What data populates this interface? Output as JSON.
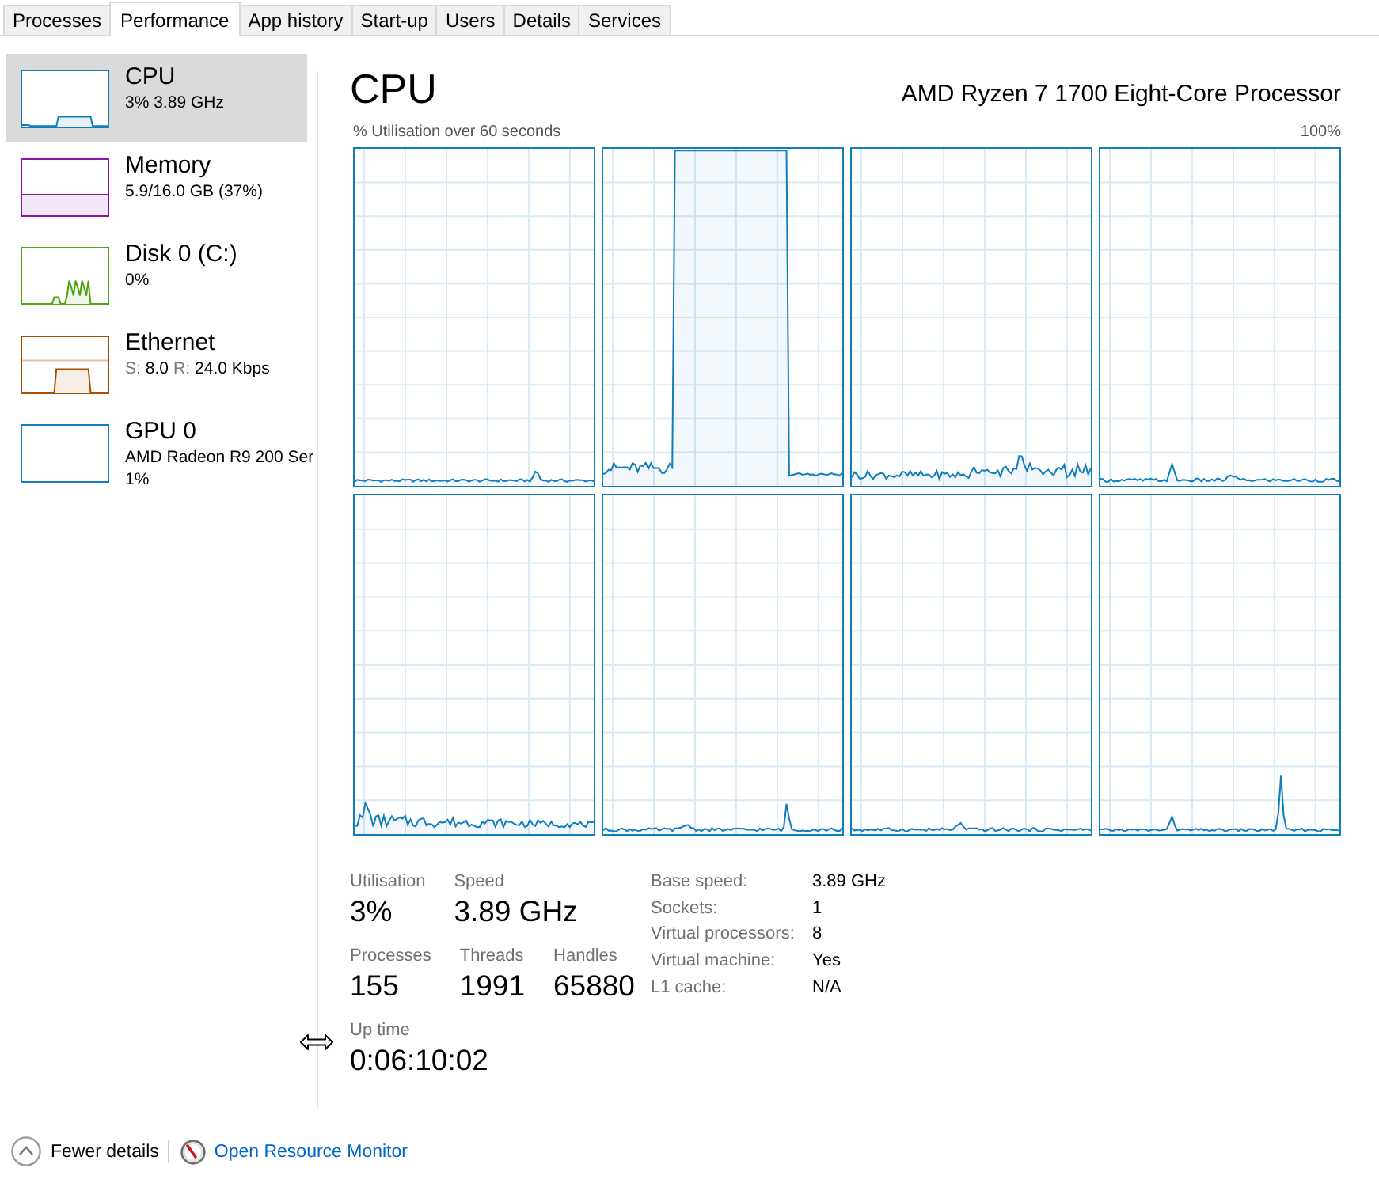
{
  "tabs": [
    {
      "label": "Processes",
      "selected": false
    },
    {
      "label": "Performance",
      "selected": true
    },
    {
      "label": "App history",
      "selected": false
    },
    {
      "label": "Start-up",
      "selected": false
    },
    {
      "label": "Users",
      "selected": false
    },
    {
      "label": "Details",
      "selected": false
    },
    {
      "label": "Services",
      "selected": false
    }
  ],
  "sidebar": {
    "items": [
      {
        "title": "CPU",
        "lines": [
          [
            {
              "text": "3% 3.89 GHz",
              "muted": false
            }
          ]
        ],
        "color": "#117dbb",
        "selected": true
      },
      {
        "title": "Memory",
        "lines": [
          [
            {
              "text": "5.9/16.0 GB (37%)",
              "muted": false
            }
          ]
        ],
        "color": "#8b12ae",
        "selected": false
      },
      {
        "title": "Disk 0 (C:)",
        "lines": [
          [
            {
              "text": "0%",
              "muted": false
            }
          ]
        ],
        "color": "#4da60c",
        "selected": false
      },
      {
        "title": "Ethernet",
        "lines": [
          [
            {
              "text": "S:",
              "muted": true
            },
            {
              "text": "8.0",
              "muted": false
            },
            {
              "text": "R:",
              "muted": true
            },
            {
              "text": "24.0 Kbps",
              "muted": false
            }
          ]
        ],
        "color": "#a74f01",
        "selected": false
      },
      {
        "title": "GPU 0",
        "lines": [
          [
            {
              "text": "AMD Radeon R9 200 Ser",
              "muted": false
            }
          ],
          [
            {
              "text": "1%",
              "muted": false
            }
          ]
        ],
        "color": "#117dbb",
        "selected": false
      }
    ]
  },
  "performance": {
    "title": "CPU",
    "processor": "AMD Ryzen 7 1700 Eight-Core Processor",
    "graph_caption": "% Utilisation over 60 seconds",
    "graph_max": "100%",
    "stats": [
      [
        {
          "label": "Utilisation",
          "value": "3%"
        },
        {
          "label": "Speed",
          "value": "3.89 GHz"
        }
      ],
      [
        {
          "label": "Processes",
          "value": "155"
        },
        {
          "label": "Threads",
          "value": "1991"
        },
        {
          "label": "Handles",
          "value": "65880"
        }
      ],
      [
        {
          "label": "Up time",
          "value": "0:06:10:02"
        }
      ]
    ],
    "specs": [
      {
        "label": "Base speed:",
        "value": "3.89 GHz"
      },
      {
        "label": "Sockets:",
        "value": "1"
      },
      {
        "label": "Virtual processors:",
        "value": "8"
      },
      {
        "label": "Virtual machine:",
        "value": "Yes"
      },
      {
        "label": "L1 cache:",
        "value": "N/A"
      }
    ]
  },
  "footer": {
    "fewer_details": "Fewer details",
    "resource_monitor": "Open Resource Monitor"
  }
}
